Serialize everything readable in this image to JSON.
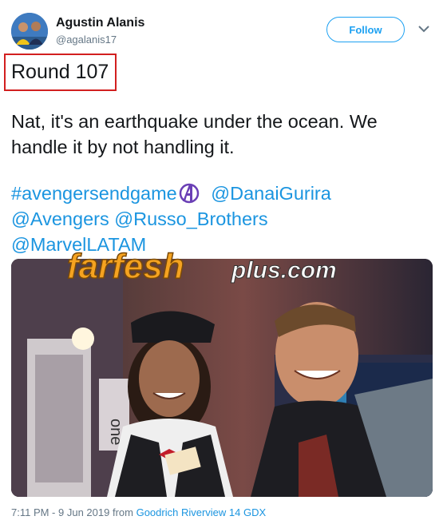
{
  "user": {
    "name": "Agustin Alanis",
    "handle": "@agalanis17"
  },
  "follow_label": "Follow",
  "overlay_label": "Round 107",
  "tweet": {
    "text_line1": "Nat, it's an earthquake under the ocean. We",
    "text_line2": "handle it by not handling it.",
    "hashtag": "#avengersendgame",
    "mention_1": "@DanaiGurira",
    "mention_2": "@Avengers",
    "mention_3": "@Russo_Brothers",
    "mention_4": "@MarvelLATAM"
  },
  "watermark": {
    "brand_main": "farfesh",
    "brand_suffix": "plus.com"
  },
  "photo_sign": "one",
  "footer": {
    "timestamp": "7:11 PM - 9 Jun 2019",
    "from_label": "from",
    "source": "Goodrich Riverview 14 GDX"
  },
  "colors": {
    "accent": "#1da1f2",
    "link": "#1b95e0",
    "overlay_border": "#d21f1f",
    "watermark_orange": "#f5a320"
  },
  "icons": {
    "avengers": "avengers-logo-icon",
    "chevron": "chevron-down-icon"
  }
}
